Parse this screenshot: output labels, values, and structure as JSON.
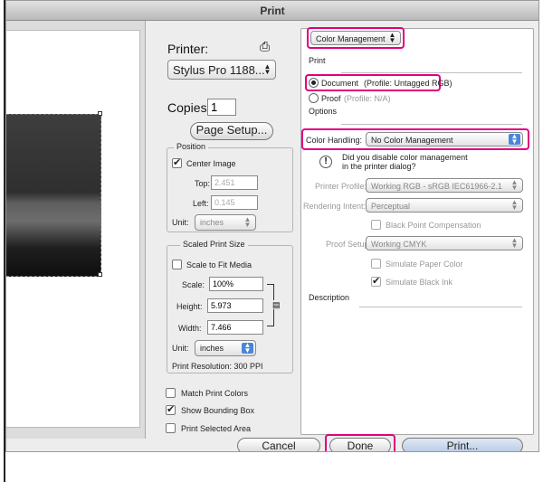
{
  "window": {
    "title": "Print"
  },
  "printer": {
    "label": "Printer:",
    "value": "Stylus Pro 1188..."
  },
  "copies": {
    "label": "Copies:",
    "value": "1"
  },
  "page_setup_button": "Page Setup...",
  "position": {
    "title": "Position",
    "center_image": "Center Image",
    "top_label": "Top:",
    "top_value": "2.451",
    "left_label": "Left:",
    "left_value": "0.145",
    "unit_label": "Unit:",
    "unit_value": "inches"
  },
  "scaled": {
    "title": "Scaled Print Size",
    "scale_to_fit": "Scale to Fit Media",
    "scale_label": "Scale:",
    "scale_value": "100%",
    "height_label": "Height:",
    "height_value": "5.973",
    "width_label": "Width:",
    "width_value": "7.466",
    "unit_label": "Unit:",
    "unit_value": "inches",
    "resolution": "Print Resolution: 300 PPI"
  },
  "options_left": {
    "match_print_colors": "Match Print Colors",
    "show_bounding_box": "Show Bounding Box",
    "print_selected_area": "Print Selected Area"
  },
  "right": {
    "mode_popup": "Color Management",
    "print_section": "Print",
    "document_label": "Document",
    "document_profile": "(Profile: Untagged RGB)",
    "proof_label": "Proof",
    "proof_profile": "(Profile: N/A)",
    "options_section": "Options",
    "color_handling_label": "Color Handling:",
    "color_handling_value": "No Color Management",
    "warning_line1": "Did you disable color management",
    "warning_line2": "in the printer dialog?",
    "printer_profile_label": "Printer Profile:",
    "printer_profile_value": "Working RGB - sRGB IEC61966-2.1",
    "rendering_intent_label": "Rendering Intent:",
    "rendering_intent_value": "Perceptual",
    "black_point": "Black Point Compensation",
    "proof_setup_label": "Proof Setup:",
    "proof_setup_value": "Working CMYK",
    "simulate_paper": "Simulate Paper Color",
    "simulate_black": "Simulate Black Ink",
    "description_section": "Description"
  },
  "buttons": {
    "cancel": "Cancel",
    "done": "Done",
    "print": "Print..."
  },
  "colors": {
    "highlight": "#e0007f",
    "popup_accent": "#4a86d8"
  }
}
